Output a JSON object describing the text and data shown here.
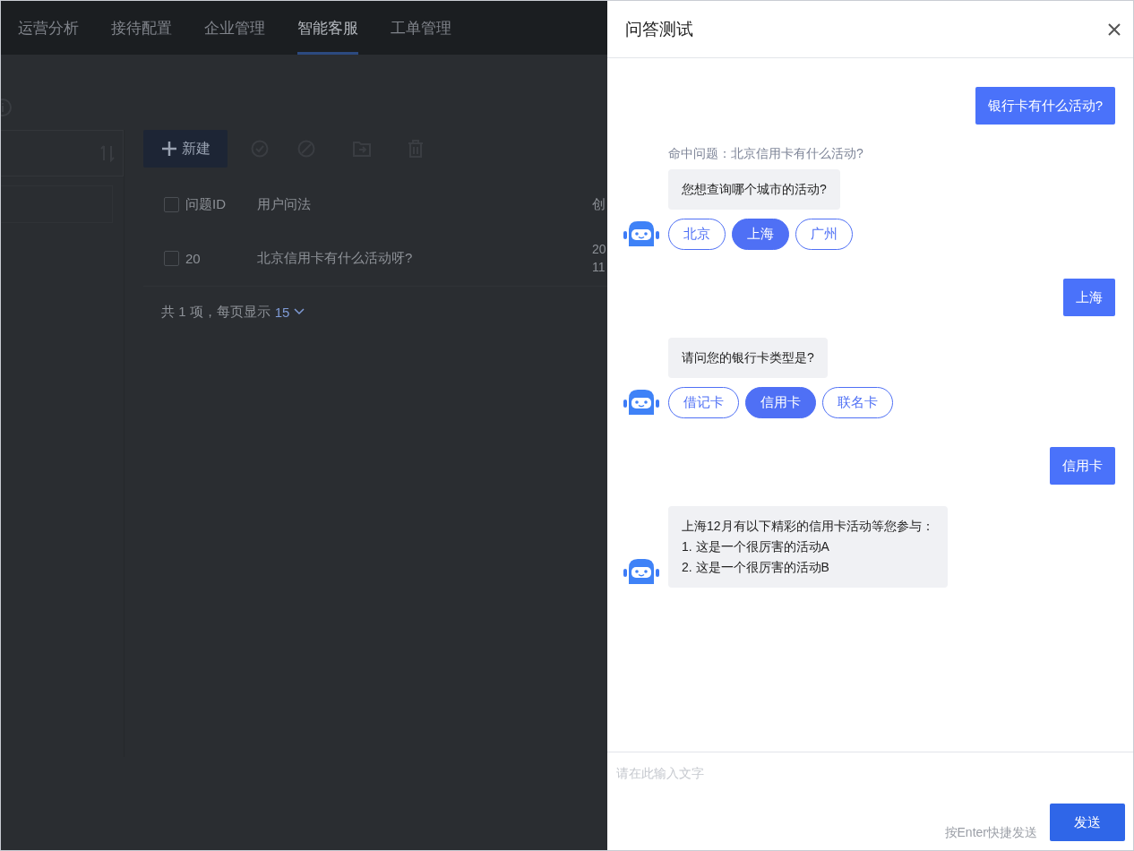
{
  "nav": {
    "tabs": [
      {
        "label": "运营分析",
        "selected": false
      },
      {
        "label": "接待配置",
        "selected": false
      },
      {
        "label": "企业管理",
        "selected": false
      },
      {
        "label": "智能客服",
        "selected": true
      },
      {
        "label": "工单管理",
        "selected": false
      }
    ]
  },
  "toolbar": {
    "new_button": "新建"
  },
  "table": {
    "all_checked": false,
    "columns": [
      "问题ID",
      "用户问法",
      "创"
    ],
    "rows": [
      {
        "checked": false,
        "cells": [
          "20",
          "北京信用卡有什么活动呀?",
          [
            "20",
            "11"
          ]
        ]
      }
    ]
  },
  "pagination": {
    "summary": "共 1 项，每页显示",
    "page_size": "15"
  },
  "drawer": {
    "title": "问答测试",
    "messages": [
      {
        "kind": "user",
        "text": "银行卡有什么活动?"
      },
      {
        "kind": "bot",
        "hit": "命中问题：北京信用卡有什么活动?",
        "lines": [
          "您想查询哪个城市的活动?"
        ],
        "options": [
          {
            "label": "北京",
            "selected": false
          },
          {
            "label": "上海",
            "selected": true
          },
          {
            "label": "广州",
            "selected": false
          }
        ]
      },
      {
        "kind": "user",
        "text": "上海"
      },
      {
        "kind": "bot",
        "lines": [
          "请问您的银行卡类型是?"
        ],
        "options": [
          {
            "label": "借记卡",
            "selected": false
          },
          {
            "label": "信用卡",
            "selected": true
          },
          {
            "label": "联名卡",
            "selected": false
          }
        ]
      },
      {
        "kind": "user",
        "text": "信用卡"
      },
      {
        "kind": "bot",
        "lines": [
          "上海12月有以下精彩的信用卡活动等您参与：",
          "1. 这是一个很厉害的活动A",
          "2. 这是一个很厉害的活动B"
        ]
      }
    ],
    "input": {
      "placeholder": "请在此输入文字"
    },
    "hint": "按Enter快捷发送",
    "send_button": "发送"
  }
}
